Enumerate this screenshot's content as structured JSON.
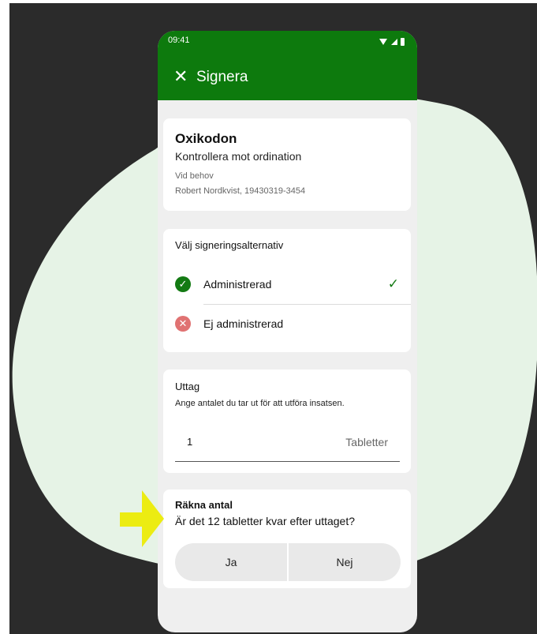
{
  "status_bar": {
    "time": "09:41"
  },
  "app_bar": {
    "close_icon": "close-icon",
    "title": "Signera"
  },
  "medication": {
    "name": "Oxikodon",
    "instruction": "Kontrollera mot ordination",
    "frequency": "Vid behov",
    "patient": "Robert Nordkvist, 19430319-3454"
  },
  "signing": {
    "title": "Välj signeringsalternativ",
    "options": [
      {
        "label": "Administrerad",
        "icon": "check-circle-icon",
        "selected": true
      },
      {
        "label": "Ej administrerad",
        "icon": "x-circle-icon",
        "selected": false
      }
    ]
  },
  "withdrawal": {
    "title": "Uttag",
    "description": "Ange antalet du tar ut för att utföra insatsen.",
    "quantity": "1",
    "unit": "Tabletter"
  },
  "count": {
    "title": "Räkna antal",
    "question": "Är det 12 tabletter kvar efter uttaget?",
    "yes_label": "Ja",
    "no_label": "Nej"
  },
  "colors": {
    "brand": "#0d7a0d",
    "accent_green": "#137a13",
    "error_red": "#e07272",
    "highlight_yellow": "#ecec12",
    "blob": "#e6f3e6",
    "backdrop": "#2b2b2b"
  }
}
